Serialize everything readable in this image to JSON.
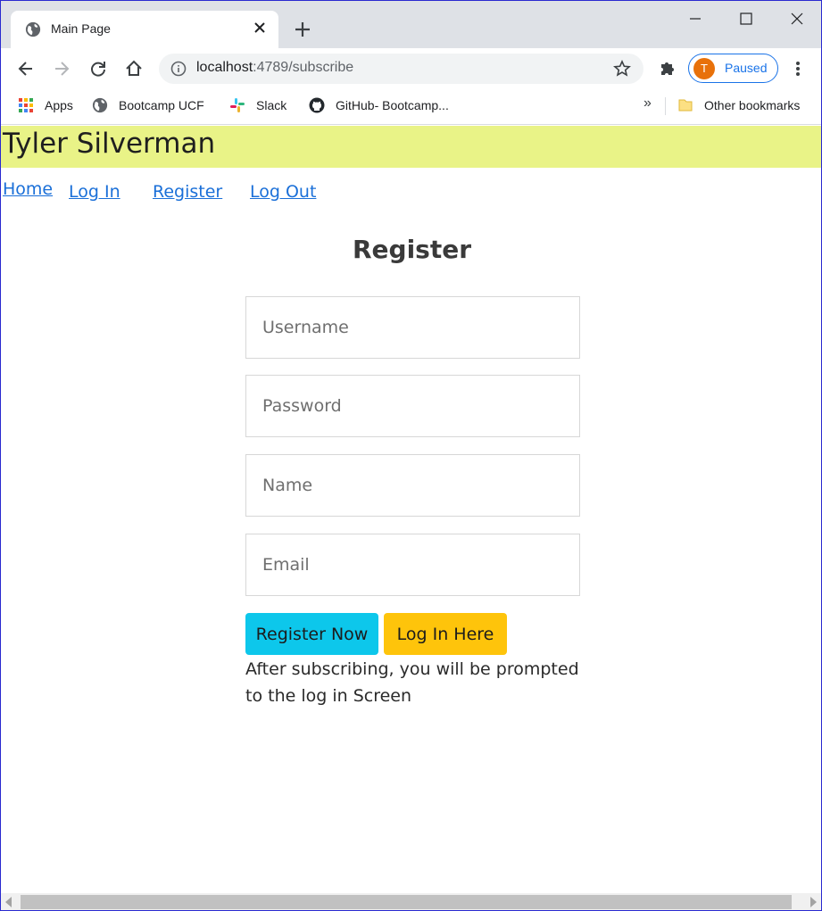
{
  "browser": {
    "tab_title": "Main Page",
    "url_host": "localhost",
    "url_rest": ":4789/subscribe",
    "profile_initial": "T",
    "profile_status": "Paused",
    "bookmarks": [
      {
        "label": "Apps",
        "icon": "apps-grid-icon"
      },
      {
        "label": "Bootcamp UCF",
        "icon": "globe-icon"
      },
      {
        "label": "Slack",
        "icon": "slack-icon"
      },
      {
        "label": "GitHub- Bootcamp...",
        "icon": "github-icon"
      }
    ],
    "bookmarks_more": "»",
    "other_bookmarks": "Other bookmarks"
  },
  "site": {
    "title": "Tyler Silverman",
    "nav": [
      "Home",
      "Log In",
      "Register",
      "Log Out"
    ]
  },
  "form": {
    "heading": "Register",
    "username_placeholder": "Username",
    "password_placeholder": "Password",
    "name_placeholder": "Name",
    "email_placeholder": "Email",
    "register_button": "Register Now",
    "login_button": "Log In Here",
    "note": "After subscribing, you will be prompted to the log in Screen"
  },
  "colors": {
    "header_bg": "#e9f387",
    "link": "#1a6fd8",
    "register_button": "#0dc7eb",
    "login_button": "#fec40b",
    "avatar": "#e8710a",
    "profile_accent": "#1a73e8"
  }
}
